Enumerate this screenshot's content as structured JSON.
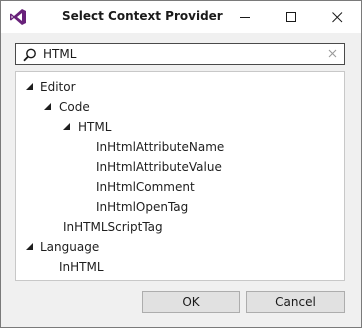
{
  "dialog": {
    "title": "Select Context Provider"
  },
  "search": {
    "value": "HTML"
  },
  "tree": {
    "items": [
      {
        "label": "Editor",
        "expanded": true
      },
      {
        "label": "Code",
        "expanded": true
      },
      {
        "label": "HTML",
        "expanded": true
      },
      {
        "label": "InHtmlAttributeName"
      },
      {
        "label": "InHtmlAttributeValue"
      },
      {
        "label": "InHtmlComment"
      },
      {
        "label": "InHtmlOpenTag"
      },
      {
        "label": "InHTMLScriptTag"
      },
      {
        "label": "Language",
        "expanded": true
      },
      {
        "label": "InHTML"
      }
    ]
  },
  "buttons": {
    "ok": "OK",
    "cancel": "Cancel"
  },
  "colors": {
    "accent": "#68217a",
    "tree_triangle": "#1e1e1e"
  }
}
